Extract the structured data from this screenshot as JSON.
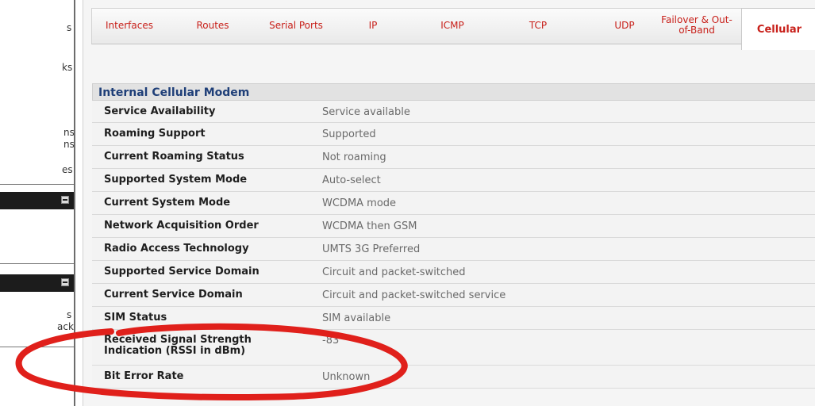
{
  "sidebar": {
    "fragments": [
      "s",
      "ks",
      "ns",
      "ns",
      "es",
      "s",
      "ackup"
    ]
  },
  "tabs": [
    {
      "label": "Interfaces",
      "active": false
    },
    {
      "label": "Routes",
      "active": false
    },
    {
      "label": "Serial Ports",
      "active": false
    },
    {
      "label": "IP",
      "active": false
    },
    {
      "label": "ICMP",
      "active": false
    },
    {
      "label": "TCP",
      "active": false
    },
    {
      "label": "UDP",
      "active": false
    },
    {
      "label": "Failover & Out-of-Band",
      "active": false
    },
    {
      "label": "Cellular",
      "active": true
    }
  ],
  "section": {
    "title": "Internal Cellular Modem",
    "rows": [
      {
        "label": "Service Availability",
        "value": "Service available"
      },
      {
        "label": "Roaming Support",
        "value": "Supported"
      },
      {
        "label": "Current Roaming Status",
        "value": "Not roaming"
      },
      {
        "label": "Supported System Mode",
        "value": "Auto-select"
      },
      {
        "label": "Current System Mode",
        "value": "WCDMA mode"
      },
      {
        "label": "Network Acquisition Order",
        "value": "WCDMA then GSM"
      },
      {
        "label": "Radio Access Technology",
        "value": "UMTS 3G Preferred"
      },
      {
        "label": "Supported Service Domain",
        "value": "Circuit and packet-switched"
      },
      {
        "label": "Current Service Domain",
        "value": "Circuit and packet-switched service"
      },
      {
        "label": "SIM Status",
        "value": "SIM available"
      },
      {
        "label": "Received Signal Strength Indication (RSSI in dBm)",
        "value": "-83"
      },
      {
        "label": "Bit Error Rate",
        "value": "Unknown"
      }
    ]
  },
  "colors": {
    "tab_text": "#c8201a",
    "section_title": "#1f3f78",
    "annotation": "#e0201b"
  }
}
